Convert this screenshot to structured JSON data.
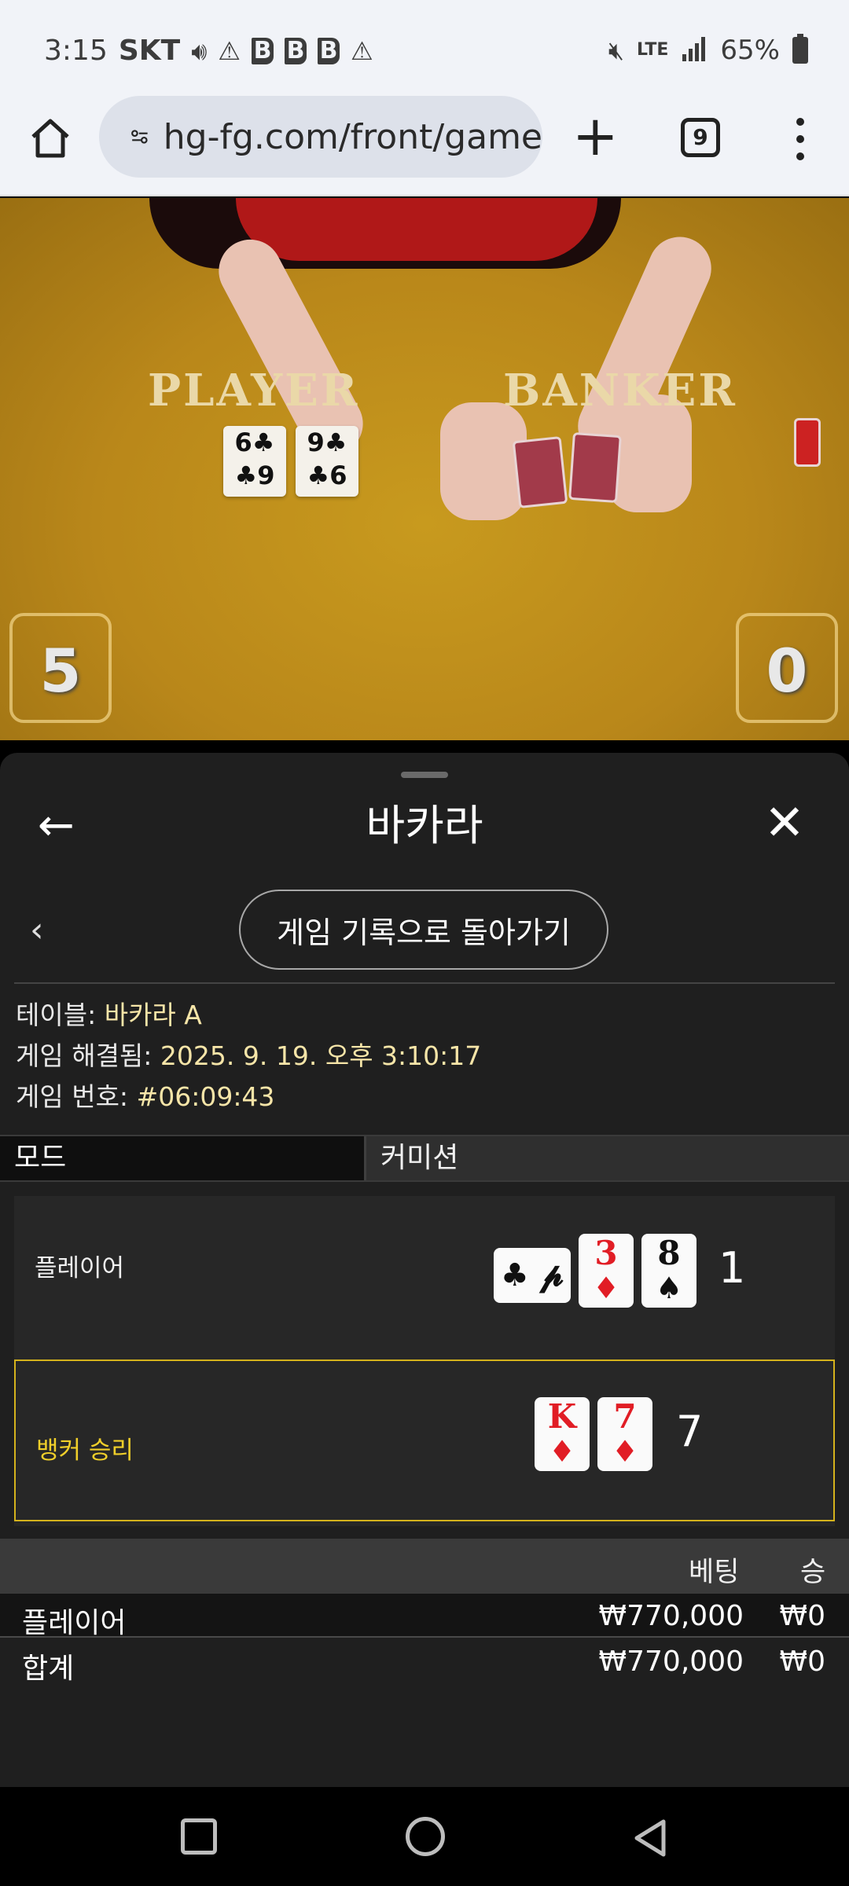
{
  "status_bar": {
    "time": "3:15",
    "carrier": "SKT",
    "battery": "65%"
  },
  "browser": {
    "url": "hg-fg.com/front/game",
    "tab_count": "9"
  },
  "video": {
    "table_label_player": "PLAYER",
    "table_label_banker": "BANKER",
    "player_cards": [
      {
        "top": "6♣",
        "bottom": "♣9"
      },
      {
        "top": "9♣",
        "bottom": "♣6"
      }
    ],
    "player_score": "5",
    "banker_score": "0"
  },
  "sheet": {
    "title": "바카라",
    "back_history_label": "게임 기록으로 돌아가기",
    "table_info_label": "테이블:",
    "table_info_value": "바카라 A",
    "resolved_label": "게임 해결됨:",
    "resolved_value": "2025. 9. 19. 오후 3:10:17",
    "game_number_label": "게임 번호:",
    "game_number_value": "#06:09:43",
    "mode_label": "모드",
    "mode_value": "커미션",
    "player_row": {
      "label": "플레이어",
      "side_card": "♣ 𝓹",
      "cards": [
        {
          "rank": "3",
          "suit": "♦",
          "color": "#e11d25"
        },
        {
          "rank": "8",
          "suit": "♠",
          "color": "#111111"
        }
      ],
      "total": "1"
    },
    "banker_row": {
      "label": "뱅커 승리",
      "cards": [
        {
          "rank": "K",
          "suit": "♦",
          "color": "#e11d25"
        },
        {
          "rank": "7",
          "suit": "♦",
          "color": "#e11d25"
        }
      ],
      "total": "7",
      "highlight_color": "#d4b21c"
    },
    "bets_header": {
      "bet": "베팅",
      "win": "승"
    },
    "bets": [
      {
        "label": "플레이어",
        "amount": "₩770,000",
        "win": "₩0"
      },
      {
        "label": "합계",
        "amount": "₩770,000",
        "win": "₩0"
      }
    ]
  }
}
